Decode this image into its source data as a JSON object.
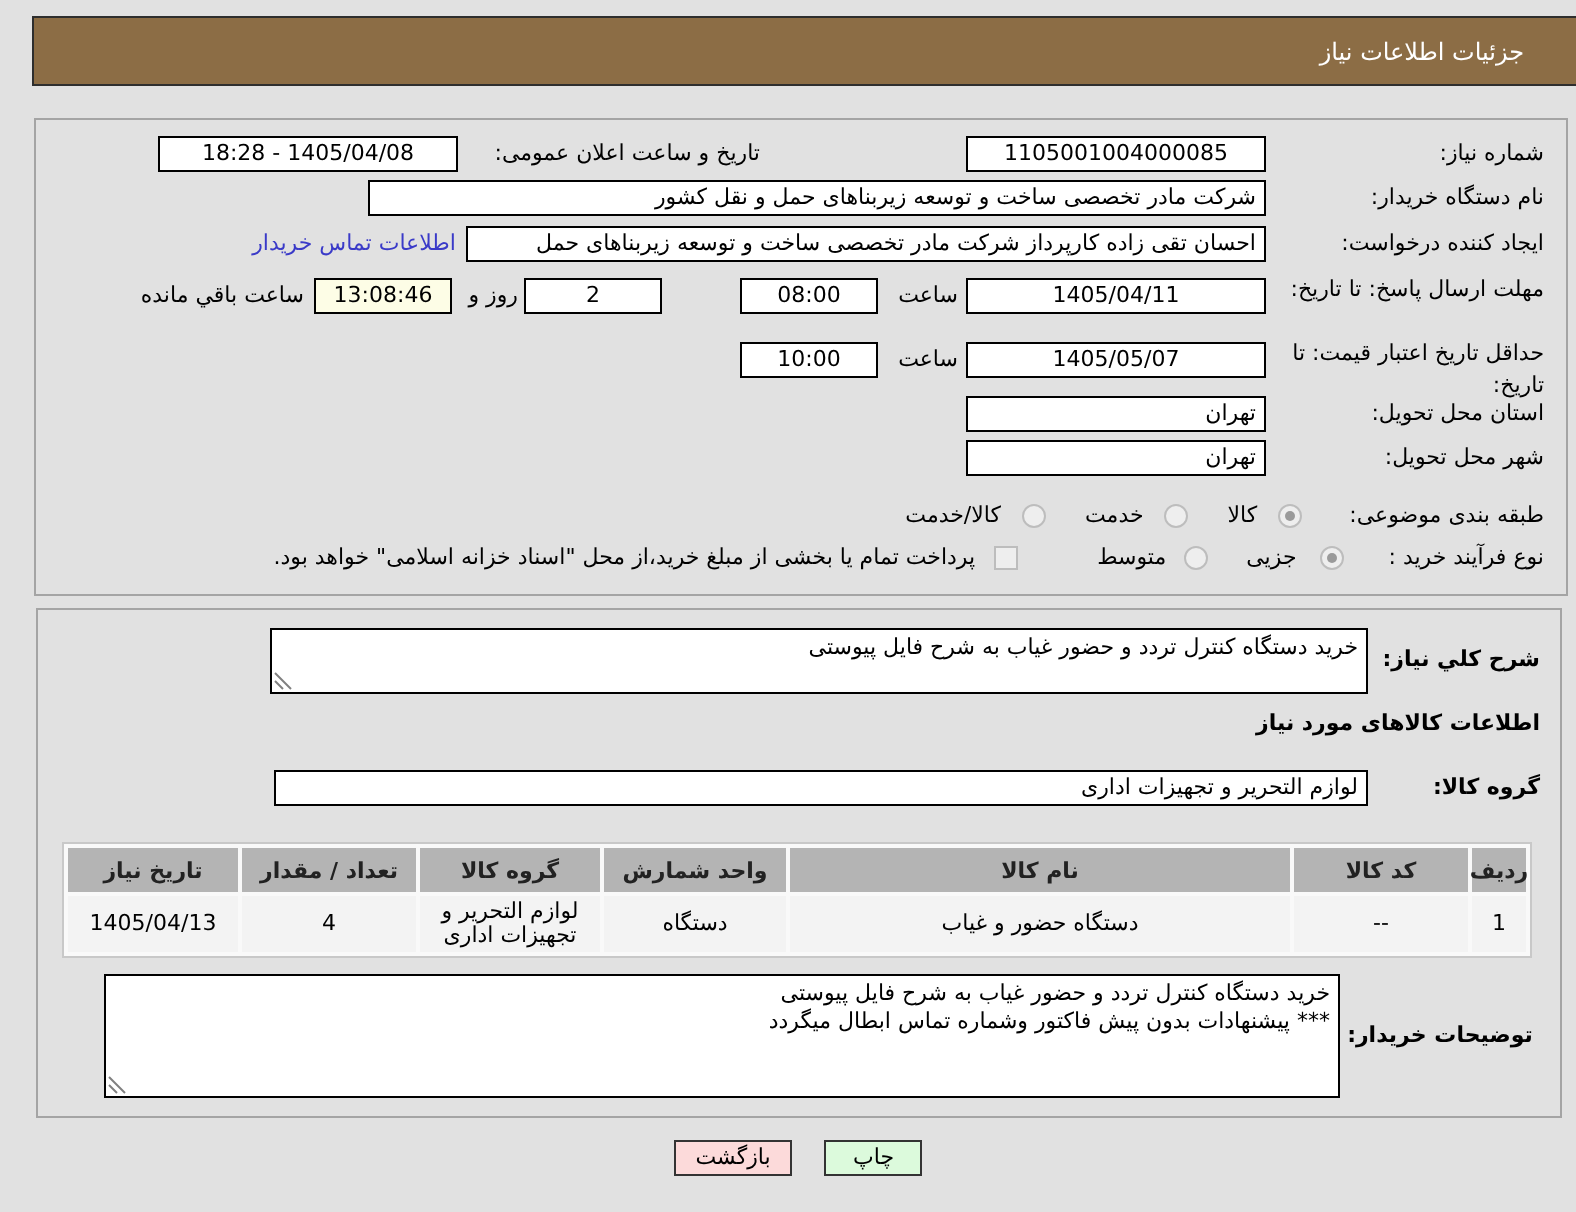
{
  "header": {
    "title": "جزئیات اطلاعات نیاز"
  },
  "details": {
    "need_number": {
      "label": "شماره نیاز:",
      "value": "1105001004000085"
    },
    "announcement": {
      "label": "تاریخ و ساعت اعلان عمومی:",
      "value": "1405/04/08 - 18:28"
    },
    "buyer_organization": {
      "label": "نام دستگاه خریدار:",
      "value": "شرکت مادر تخصصی ساخت و توسعه زیربناهای حمل و نقل کشور"
    },
    "requester": {
      "label": "ایجاد کننده درخواست:",
      "value": "احسان تقی زاده کارپرداز شرکت مادر تخصصی ساخت و توسعه زیربناهای حمل",
      "contact_link": "اطلاعات تماس خریدار"
    },
    "response_deadline": {
      "label": "مهلت ارسال پاسخ: تا تاریخ:",
      "date": "1405/04/11",
      "time_label": "ساعت",
      "time": "08:00",
      "days": "2",
      "days_label": "روز و",
      "remaining_time": "13:08:46",
      "remaining_label": "ساعت باقي مانده"
    },
    "price_validity": {
      "label": "حداقل تاریخ اعتبار قیمت: تا تاریخ:",
      "date": "1405/05/07",
      "time_label": "ساعت",
      "time": "10:00"
    },
    "delivery_province": {
      "label": "استان محل تحویل:",
      "value": "تهران"
    },
    "delivery_city": {
      "label": "شهر محل تحویل:",
      "value": "تهران"
    },
    "subject_category": {
      "label": "طبقه بندی موضوعی:",
      "options": [
        {
          "label": "کالا",
          "selected": true,
          "disabled": true
        },
        {
          "label": "خدمت",
          "selected": false,
          "disabled": true
        },
        {
          "label": "کالا/خدمت",
          "selected": false,
          "disabled": true
        }
      ]
    },
    "purchase_process": {
      "label": "نوع فرآیند خرید :",
      "options": [
        {
          "label": "جزیی",
          "selected": true,
          "disabled": true
        },
        {
          "label": "متوسط",
          "selected": false,
          "disabled": true
        }
      ],
      "treasury_option": {
        "label": "پرداخت تمام یا بخشی از مبلغ خرید،از محل \"اسناد خزانه اسلامی\" خواهد بود.",
        "checked": false,
        "disabled": true
      }
    }
  },
  "goods": {
    "description": {
      "label": "شرح کلي نياز:",
      "value": "خرید دستگاه کنترل تردد و حضور غیاب به شرح فایل پیوستی"
    },
    "heading": "اطلاعات کالاهای مورد نیاز",
    "goods_group": {
      "label": "گروه کالا:",
      "value": "لوازم التحریر و تجهیزات اداری"
    },
    "table": {
      "columns": [
        "ردیف",
        "کد کالا",
        "نام کالا",
        "واحد شمارش",
        "گروه کالا",
        "تعداد / مقدار",
        "تاریخ نیاز"
      ],
      "rows": [
        [
          "1",
          "--",
          "دستگاه حضور و غیاب",
          "دستگاه",
          "لوازم التحریر و تجهیزات اداری",
          "4",
          "1405/04/13"
        ]
      ]
    },
    "buyer_notes": {
      "label": "توضیحات خریدار:",
      "lines": [
        "خرید دستگاه کنترل تردد و حضور غیاب به شرح فایل پیوستی",
        "*** پیشنهادات بدون پیش فاکتور وشماره تماس ابطال میگردد"
      ]
    }
  },
  "buttons": [
    {
      "label": "چاپ",
      "kind": "print"
    },
    {
      "label": "بازگشت",
      "kind": "back"
    }
  ]
}
